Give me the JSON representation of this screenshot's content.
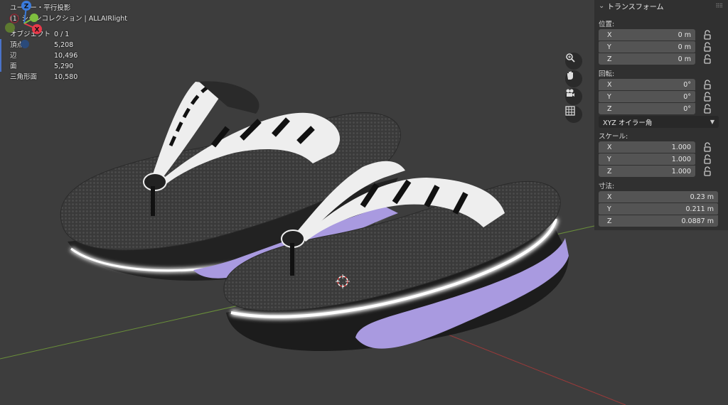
{
  "viewport": {
    "view_name": "ユーザー・平行投影",
    "collection": "(1) シーンコレクション | ALLAIRlight",
    "stats": [
      {
        "label": "オブジェクト",
        "value": "0 / 1"
      },
      {
        "label": "頂点",
        "value": "5,208"
      },
      {
        "label": "辺",
        "value": "10,496"
      },
      {
        "label": "面",
        "value": "5,290"
      },
      {
        "label": "三角形面",
        "value": "10,580"
      }
    ]
  },
  "gizmo": {
    "z": "Z",
    "x": "X",
    "y": "Y"
  },
  "tools": [
    {
      "name": "zoom-icon"
    },
    {
      "name": "hand-icon"
    },
    {
      "name": "camera-icon"
    },
    {
      "name": "grid-icon"
    }
  ],
  "panel": {
    "title": "トランスフォーム",
    "location": {
      "label": "位置:",
      "x": {
        "label": "X",
        "value": "0 m"
      },
      "y": {
        "label": "Y",
        "value": "0 m"
      },
      "z": {
        "label": "Z",
        "value": "0 m"
      }
    },
    "rotation": {
      "label": "回転:",
      "x": {
        "label": "X",
        "value": "0°"
      },
      "y": {
        "label": "Y",
        "value": "0°"
      },
      "z": {
        "label": "Z",
        "value": "0°"
      }
    },
    "rotation_mode": "XYZ オイラー角",
    "scale": {
      "label": "スケール:",
      "x": {
        "label": "X",
        "value": "1.000"
      },
      "y": {
        "label": "Y",
        "value": "1.000"
      },
      "z": {
        "label": "Z",
        "value": "1.000"
      }
    },
    "dimensions": {
      "label": "寸法:",
      "x": {
        "label": "X",
        "value": "0.23 m"
      },
      "y": {
        "label": "Y",
        "value": "0.211 m"
      },
      "z": {
        "label": "Z",
        "value": "0.0887 m"
      }
    }
  },
  "colors": {
    "background": "#3d3d3d",
    "panel": "#303030",
    "field": "#545454",
    "axis_x": "#e8394a",
    "axis_y": "#7fbf3f",
    "axis_z": "#3a7bdc",
    "sole_lavender": "#a99ae0"
  }
}
